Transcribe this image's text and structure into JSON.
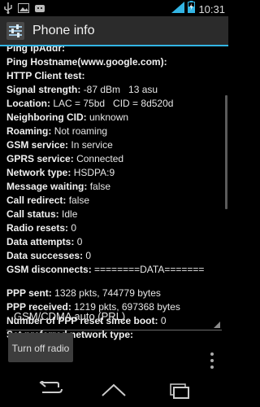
{
  "status_bar": {
    "time": "10:31",
    "left_icons": [
      "usb-icon",
      "image-icon",
      "android-debug-icon"
    ],
    "right_icons": [
      "signal-icon",
      "battery-charging-icon"
    ]
  },
  "action_bar": {
    "title": "Phone info",
    "accent_color": "#33b5e5"
  },
  "info": {
    "ping_ipaddr": {
      "label": "Ping IpAddr:",
      "value": ""
    },
    "ping_hostname": {
      "label": "Ping Hostname(www.google.com):",
      "value": ""
    },
    "http_client_test": {
      "label": "HTTP Client test:",
      "value": ""
    },
    "signal_strength": {
      "label": "Signal strength:",
      "value": "-87 dBm   13 asu"
    },
    "location": {
      "label": "Location:",
      "value": "LAC = 75bd   CID = 8d520d"
    },
    "neighboring_cid": {
      "label": "Neighboring CID:",
      "value": "unknown"
    },
    "roaming": {
      "label": "Roaming:",
      "value": "Not roaming"
    },
    "gsm_service": {
      "label": "GSM service:",
      "value": "In service"
    },
    "gprs_service": {
      "label": "GPRS service:",
      "value": "Connected"
    },
    "network_type": {
      "label": "Network type:",
      "value": "HSDPA:9"
    },
    "message_waiting": {
      "label": "Message waiting:",
      "value": "false"
    },
    "call_redirect": {
      "label": "Call redirect:",
      "value": "false"
    },
    "call_status": {
      "label": "Call status:",
      "value": "Idle"
    },
    "radio_resets": {
      "label": "Radio resets:",
      "value": "0"
    },
    "data_attempts": {
      "label": "Data attempts:",
      "value": "0"
    },
    "data_successes": {
      "label": "Data successes:",
      "value": "0"
    },
    "gsm_disconnects": {
      "label": "GSM disconnects:",
      "value": "========DATA======="
    },
    "ppp_sent": {
      "label": "PPP sent:",
      "value": "1328 pkts, 744779 bytes"
    },
    "ppp_received": {
      "label": "PPP received:",
      "value": "1219 pkts, 697368 bytes"
    },
    "ppp_resets": {
      "label": "Number of PPP reset since boot:",
      "value": "0"
    },
    "preferred_network_label": "Set preferred network type:"
  },
  "network_spinner": {
    "selected": "GSM/CDMA auto (PRL)"
  },
  "radio_button": {
    "label": "Turn off radio"
  },
  "nav_bar": {
    "icons": [
      "back-icon",
      "home-icon",
      "recent-apps-icon"
    ]
  }
}
